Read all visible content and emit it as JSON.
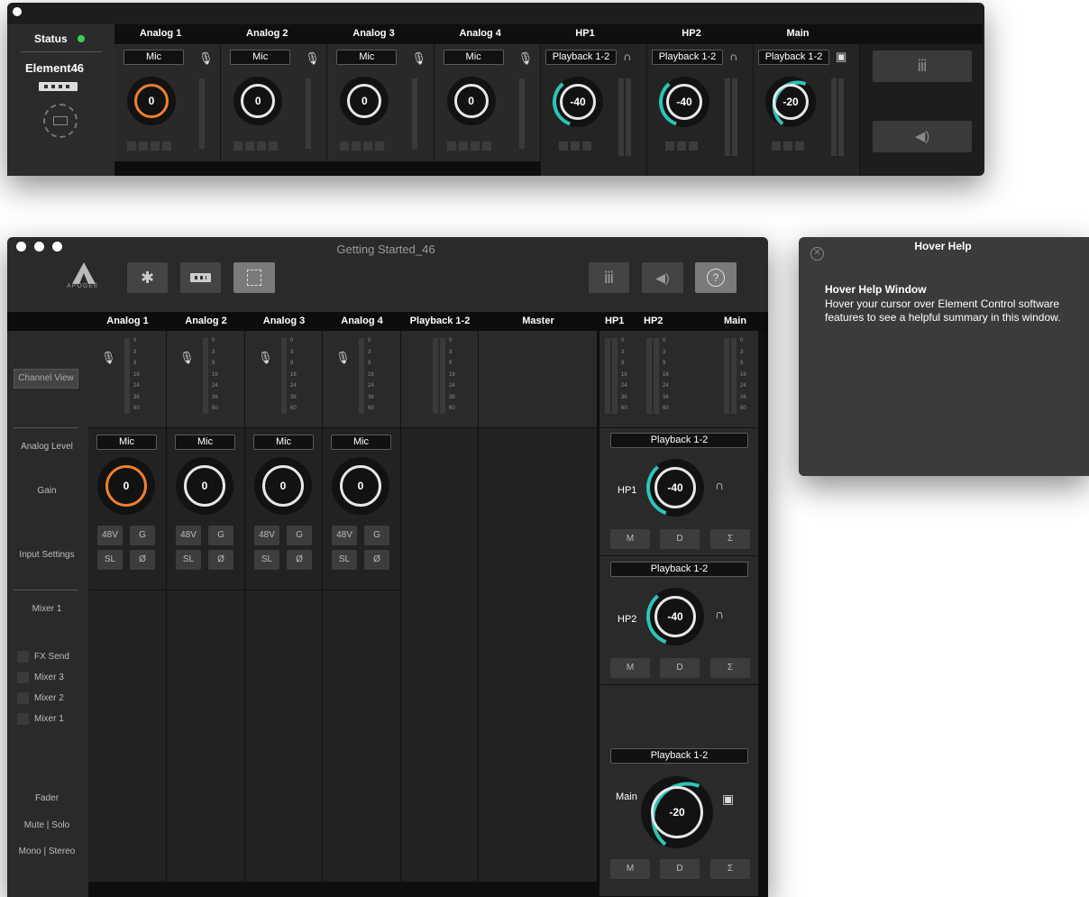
{
  "top": {
    "status": "Status",
    "device": "Element46",
    "channels": [
      {
        "label": "Analog 1",
        "input": "Mic",
        "value": "0",
        "accent": "#f07f2e"
      },
      {
        "label": "Analog 2",
        "input": "Mic",
        "value": "0",
        "accent": "#e8e8e8"
      },
      {
        "label": "Analog 3",
        "input": "Mic",
        "value": "0",
        "accent": "#e8e8e8"
      },
      {
        "label": "Analog 4",
        "input": "Mic",
        "value": "0",
        "accent": "#e8e8e8"
      }
    ],
    "outputs": [
      {
        "label": "HP1",
        "source": "Playback 1-2",
        "value": "-40",
        "icon": "headphones-icon"
      },
      {
        "label": "HP2",
        "source": "Playback 1-2",
        "value": "-40",
        "icon": "headphones-icon"
      },
      {
        "label": "Main",
        "source": "Playback 1-2",
        "value": "-20",
        "icon": "speaker-icon"
      }
    ]
  },
  "main": {
    "title": "Getting Started_46",
    "logo_text": "APOGEE",
    "help_button": "?",
    "columns": [
      "Analog 1",
      "Analog 2",
      "Analog 3",
      "Analog 4",
      "Playback 1-2",
      "Master"
    ],
    "out_headers": [
      "HP1",
      "HP2",
      "Main"
    ],
    "side": {
      "channel_view": "Channel View",
      "analog_level": "Analog Level",
      "gain": "Gain",
      "input_settings": "Input Settings",
      "mixer1": "Mixer 1",
      "sends": [
        "FX Send",
        "Mixer 3",
        "Mixer 2",
        "Mixer 1"
      ],
      "fader": "Fader",
      "mute_solo": "Mute | Solo",
      "mono_stereo": "Mono | Stereo"
    },
    "meter_ticks": [
      "0",
      "3",
      "9",
      "16",
      "24",
      "36",
      "60"
    ],
    "inputs": [
      {
        "input": "Mic",
        "value": "0",
        "b48": "48V",
        "g": "G",
        "sl": "SL",
        "ph": "Ø"
      },
      {
        "input": "Mic",
        "value": "0",
        "b48": "48V",
        "g": "G",
        "sl": "SL",
        "ph": "Ø"
      },
      {
        "input": "Mic",
        "value": "0",
        "b48": "48V",
        "g": "G",
        "sl": "SL",
        "ph": "Ø"
      },
      {
        "input": "Mic",
        "value": "0",
        "b48": "48V",
        "g": "G",
        "sl": "SL",
        "ph": "Ø"
      }
    ],
    "outputs": [
      {
        "label": "HP1",
        "source": "Playback 1-2",
        "value": "-40",
        "m": "M",
        "d": "D",
        "s": "Σ"
      },
      {
        "label": "HP2",
        "source": "Playback 1-2",
        "value": "-40",
        "m": "M",
        "d": "D",
        "s": "Σ"
      },
      {
        "label": "Main",
        "source": "Playback 1-2",
        "value": "-20",
        "m": "M",
        "d": "D",
        "s": "Σ"
      }
    ]
  },
  "help": {
    "title": "Hover Help",
    "heading": "Hover Help Window",
    "body": "Hover your cursor over Element Control software features to see a helpful summary in this window."
  },
  "colors": {
    "accent_orange": "#f07f2e",
    "accent_teal": "#2ec4b6",
    "status_green": "#3ccf4e"
  }
}
